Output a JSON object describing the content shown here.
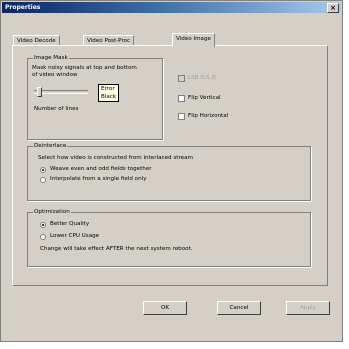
{
  "window": {
    "title": "Properties"
  },
  "tabs": [
    "Video Decode",
    "Video Post-Proc",
    "Video Image"
  ],
  "image_mask": {
    "legend": "Image Mask",
    "description_line1": "Mask noisy signals at top and bottom",
    "description_line2": "of video window",
    "slider_label": "Number of lines",
    "slider_value_fraction": 0.1,
    "tooltip_line1": "Error",
    "tooltip_line2": "Black"
  },
  "options": {
    "disabled_check_label": "LSB O.S.D",
    "flip_vertical": "Flip Vertical",
    "flip_horizontal": "Flip Horizontal"
  },
  "deinterlace": {
    "legend": "Deinterlace",
    "description": "Select how video is constructed from interlaced stream",
    "option1": "Weave even and odd fields together",
    "option2": "Interpolate from a single field only"
  },
  "optimization": {
    "legend": "Optimization",
    "option1": "Better Quality",
    "option2": "Lower CPU Usage",
    "note": "Change will take effect AFTER the next system reboot."
  },
  "buttons": {
    "ok": "OK",
    "cancel": "Cancel",
    "apply": "Apply"
  }
}
